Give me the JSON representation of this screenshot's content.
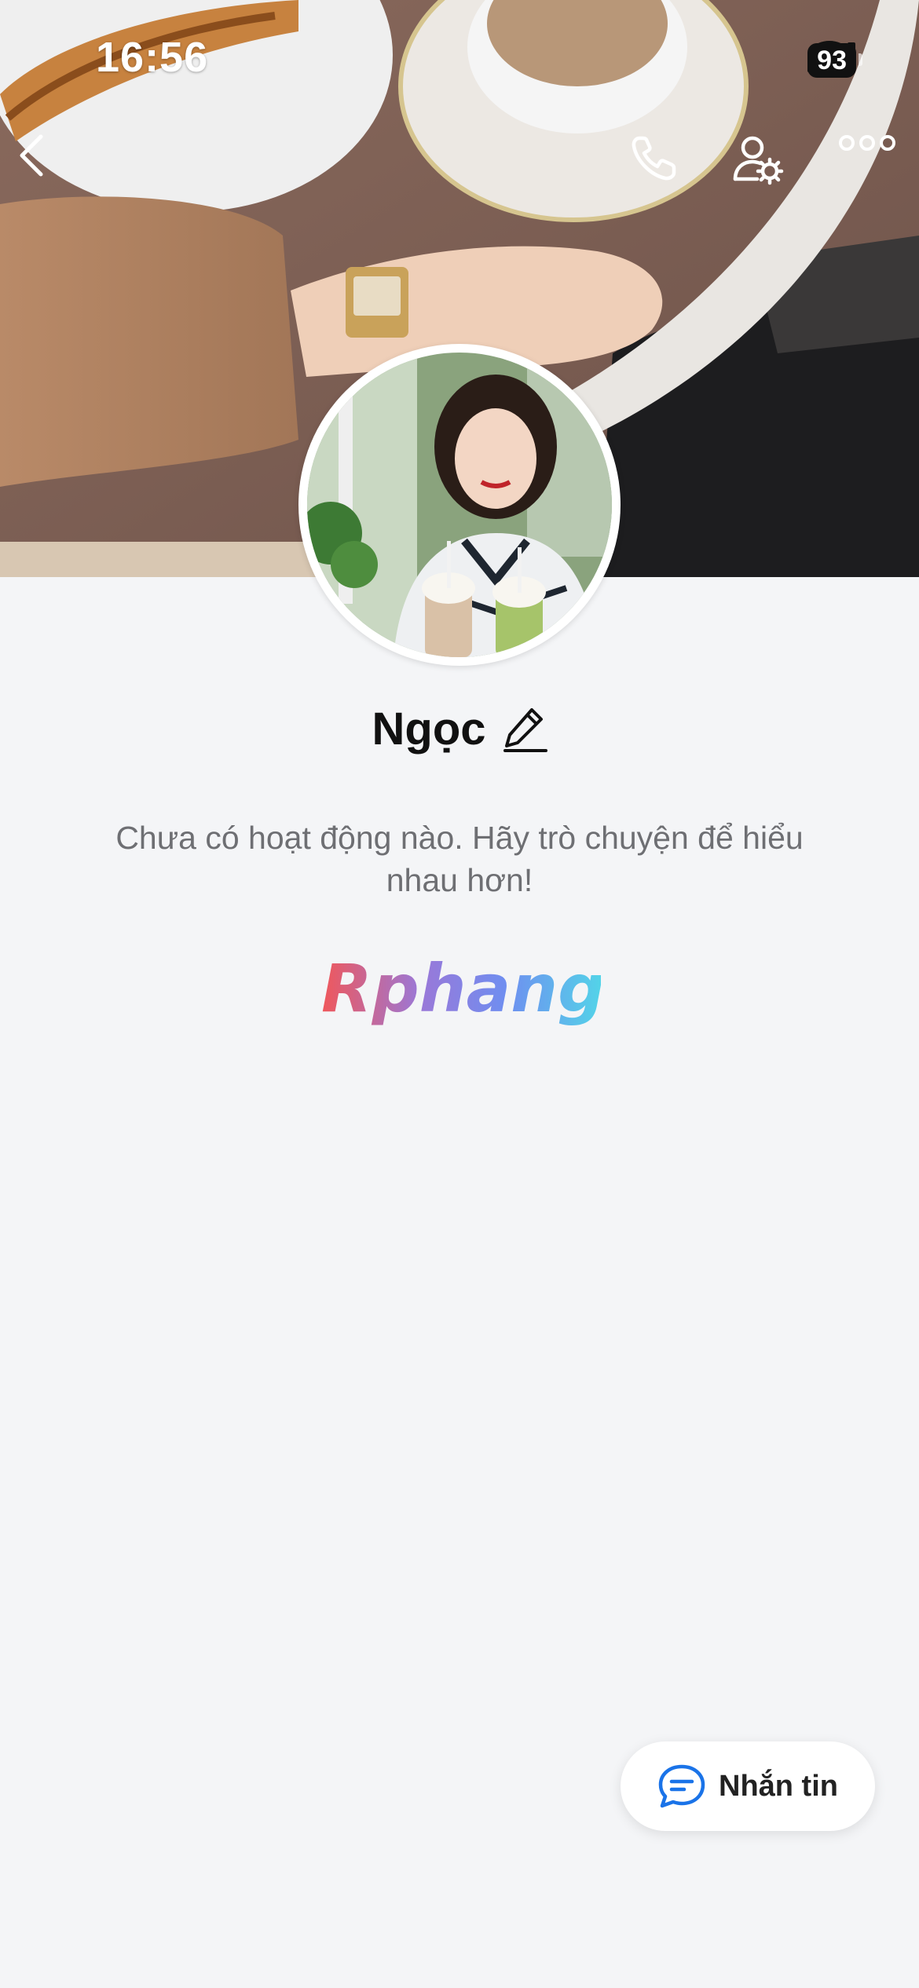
{
  "status_bar": {
    "time": "16:56",
    "battery": "93"
  },
  "nav": {
    "back_icon": "chevron-left-icon",
    "call_icon": "phone-icon",
    "settings_icon": "user-settings-icon",
    "more_icon": "more-dots-icon"
  },
  "profile": {
    "name": "Ngọc",
    "edit_icon": "pencil-icon",
    "empty_text": "Chưa có hoạt động nào. Hãy trò chuyện để hiểu nhau hơn!"
  },
  "watermark": {
    "text": "Rphang"
  },
  "message_button": {
    "label": "Nhắn tin",
    "icon": "chat-bubble-icon",
    "accent": "#1a73e8"
  }
}
